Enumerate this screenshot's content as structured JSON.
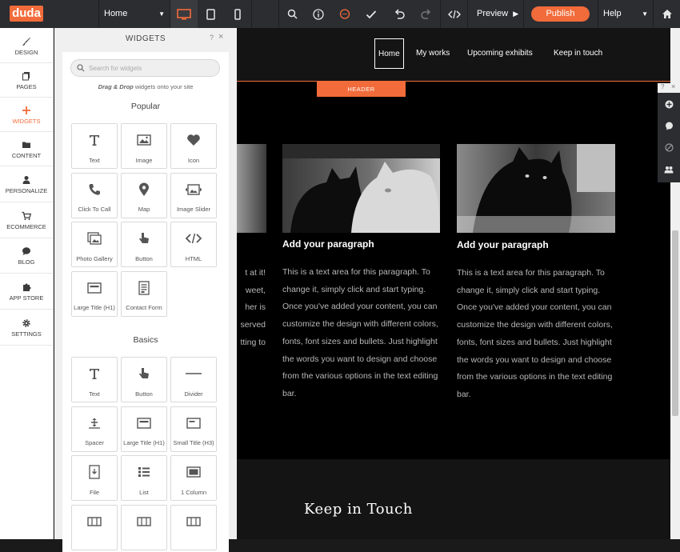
{
  "app": {
    "logo_text": "duda"
  },
  "toolbar": {
    "page_select": "Home",
    "preview_label": "Preview",
    "publish_label": "Publish",
    "help_label": "Help",
    "accent": "#f26b3a"
  },
  "leftnav": {
    "items": [
      {
        "label": "DESIGN",
        "icon": "brush-icon"
      },
      {
        "label": "PAGES",
        "icon": "pages-icon"
      },
      {
        "label": "WIDGETS",
        "icon": "plus-icon"
      },
      {
        "label": "CONTENT",
        "icon": "folder-icon"
      },
      {
        "label": "PERSONALIZE",
        "icon": "person-icon"
      },
      {
        "label": "ECOMMERCE",
        "icon": "cart-icon"
      },
      {
        "label": "BLOG",
        "icon": "chat-icon"
      },
      {
        "label": "APP STORE",
        "icon": "puzzle-icon"
      },
      {
        "label": "SETTINGS",
        "icon": "gear-icon"
      }
    ]
  },
  "panel": {
    "title": "WIDGETS",
    "help": "?",
    "close": "×",
    "search_placeholder": "Search for widgets",
    "hint_bold": "Drag & Drop",
    "hint_rest": " widgets onto your site",
    "popular_title": "Popular",
    "basics_title": "Basics",
    "popular": [
      "Text",
      "Image",
      "Icon",
      "Click To Call",
      "Map",
      "Image Slider",
      "Photo Gallery",
      "Button",
      "HTML",
      "Large Title (H1)",
      "Contact Form"
    ],
    "basics": [
      "Text",
      "Button",
      "Divider",
      "Spacer",
      "Large Title (H1)",
      "Small Title (H3)",
      "File",
      "List",
      "1 Column",
      "",
      "",
      ""
    ]
  },
  "site": {
    "nav": [
      "Home",
      "My works",
      "Upcoming exhibits",
      "Keep in touch"
    ],
    "header_badge": "HEADER",
    "columns": [
      {
        "title": "Add your paragraph",
        "text": "This is a text area for this paragraph. To change it, simply click and start typing. Once you've added your content, you can customize the design with different colors, fonts, font sizes and bullets. Just highlight the words you want to design and choose from the various options in the text editing bar."
      },
      {
        "title": "Add your paragraph",
        "text": "This is a text area for this paragraph. To change it, simply click and start typing. Once you've added your content, you can customize the design with different colors, fonts, font sizes and bullets. Just highlight the words you want to design and choose from the various options in the text editing bar."
      }
    ],
    "left_fragments": [
      "t at it!",
      "weet,",
      "her is",
      "served",
      "tting to"
    ],
    "keep_title": "Keep in Touch"
  }
}
